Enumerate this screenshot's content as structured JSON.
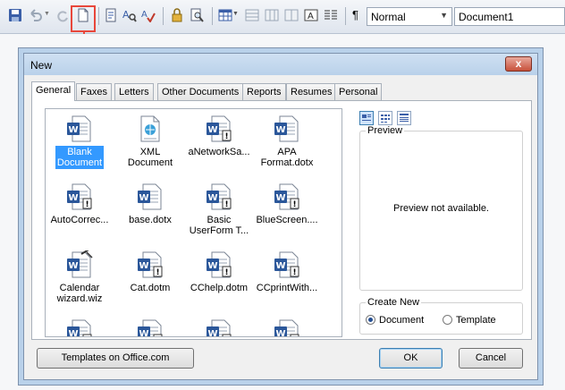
{
  "toolbar": {
    "style_combo": "Normal",
    "font_combo": "Document1",
    "icons": [
      "save-icon",
      "undo-icon",
      "undo-dropdown-icon",
      "redo-icon",
      "new-document-icon",
      "print-preview-icon",
      "find-icon",
      "spelling-icon",
      "protect-icon",
      "zoom-icon",
      "table-icon",
      "insert-rows-icon",
      "insert-cols-icon",
      "merge-cells-icon",
      "text-box-icon",
      "columns-icon",
      "pilcrow-icon"
    ]
  },
  "dialog": {
    "title": "New",
    "close_label": "x",
    "tabs": [
      {
        "label": "General",
        "active": true
      },
      {
        "label": "Faxes"
      },
      {
        "label": "Letters"
      },
      {
        "label": "Other Documents"
      },
      {
        "label": "Reports"
      },
      {
        "label": "Resumes"
      },
      {
        "label": "Personal"
      }
    ],
    "templates": [
      {
        "label": "Blank Document",
        "lines": [
          "Blank",
          "Document"
        ],
        "icon": "word-document-icon",
        "selected": true
      },
      {
        "label": "XML Document",
        "lines": [
          "XML Document"
        ],
        "icon": "xml-document-icon"
      },
      {
        "label": "aNetworkSa...",
        "lines": [
          "aNetworkSa..."
        ],
        "icon": "word-template-icon"
      },
      {
        "label": "APA Format.dotx",
        "lines": [
          "APA",
          "Format.dotx"
        ],
        "icon": "word-document-icon"
      },
      {
        "label": "AutoCorrec...",
        "lines": [
          "AutoCorrec..."
        ],
        "icon": "word-template-icon"
      },
      {
        "label": "base.dotx",
        "lines": [
          "base.dotx"
        ],
        "icon": "word-document-icon"
      },
      {
        "label": "Basic UserForm T...",
        "lines": [
          "Basic",
          "UserForm T..."
        ],
        "icon": "word-template-icon"
      },
      {
        "label": "BlueScreen....",
        "lines": [
          "BlueScreen...."
        ],
        "icon": "word-template-icon"
      },
      {
        "label": "Calendar wizard.wiz",
        "lines": [
          "Calendar",
          "wizard.wiz"
        ],
        "icon": "word-wizard-icon"
      },
      {
        "label": "Cat.dotm",
        "lines": [
          "Cat.dotm"
        ],
        "icon": "word-template-icon"
      },
      {
        "label": "CChelp.dotm",
        "lines": [
          "CChelp.dotm"
        ],
        "icon": "word-template-icon"
      },
      {
        "label": "CCprintWith...",
        "lines": [
          "CCprintWith..."
        ],
        "icon": "word-template-icon"
      },
      {
        "label": "",
        "lines": [],
        "icon": "word-template-icon"
      },
      {
        "label": "",
        "lines": [],
        "icon": "word-template-icon"
      },
      {
        "label": "",
        "lines": [],
        "icon": "word-template-icon"
      },
      {
        "label": "",
        "lines": [],
        "icon": "word-template-icon"
      }
    ],
    "view_buttons": [
      "large-icons-view-icon",
      "list-view-icon",
      "details-view-icon"
    ],
    "preview": {
      "group_label": "Preview",
      "text": "Preview not available."
    },
    "create_new": {
      "group_label": "Create New",
      "options": [
        {
          "label": "Document",
          "checked": true
        },
        {
          "label": "Template",
          "checked": false
        }
      ]
    },
    "buttons": {
      "templates_office": "Templates on Office.com",
      "ok": "OK",
      "cancel": "Cancel"
    }
  },
  "colors": {
    "highlight": "#e8473b",
    "selection": "#3399ff",
    "word_blue": "#2b579a"
  }
}
